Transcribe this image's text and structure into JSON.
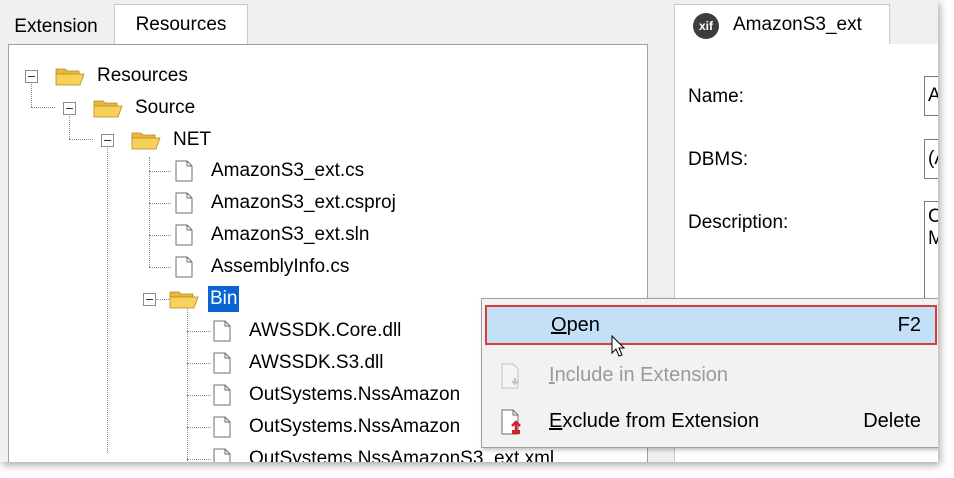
{
  "left_tabs": [
    "Extension",
    "Resources"
  ],
  "tree": {
    "resources": "Resources",
    "source": "Source",
    "net": "NET",
    "files_net": [
      "AmazonS3_ext.cs",
      "AmazonS3_ext.csproj",
      "AmazonS3_ext.sln",
      "AssemblyInfo.cs"
    ],
    "bin": "Bin",
    "files_bin": [
      "AWSSDK.Core.dll",
      "AWSSDK.S3.dll",
      "OutSystems.NssAmazon",
      "OutSystems.NssAmazon",
      "OutSystems.NssAmazonS3_ext.xml"
    ]
  },
  "right_tab": {
    "badge": "xif",
    "title": "AmazonS3_ext"
  },
  "form": {
    "name_label": "Name:",
    "name_value": "A",
    "dbms_label": "DBMS:",
    "dbms_value": "(A",
    "description_label": "Description:",
    "description_value_line1": "C",
    "description_value_line2": "M"
  },
  "context_menu": {
    "open": {
      "prefix": "",
      "underlined": "O",
      "rest": "pen",
      "shortcut": "F2"
    },
    "include": {
      "underlined": "I",
      "rest": "nclude in Extension",
      "shortcut": ""
    },
    "exclude": {
      "underlined": "E",
      "rest": "xclude from Extension",
      "shortcut": "Delete"
    }
  },
  "colors": {
    "selection": "#0a64d2",
    "menu_highlight": "#c4e0f7",
    "highlight_border": "#d93a3a",
    "folder": "#f5c542"
  }
}
